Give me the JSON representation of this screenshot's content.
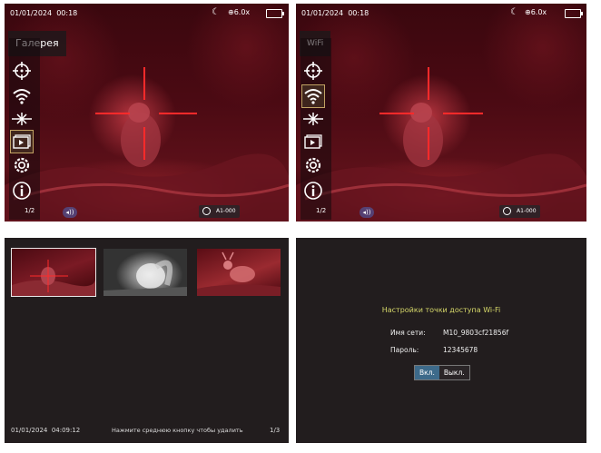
{
  "panels": {
    "gallery_menu": {
      "date": "01/01/2024",
      "time": "00:18",
      "zoom": "6.0x",
      "menu_title": "Галерея",
      "page": "1/2",
      "rec_label": "A1-000",
      "selected_item": "gallery"
    },
    "wifi_menu": {
      "date": "01/01/2024",
      "time": "00:18",
      "zoom": "6.0x",
      "menu_title": "WiFi",
      "page": "1/2",
      "rec_label": "A1-000",
      "selected_item": "wifi"
    },
    "gallery_view": {
      "date": "01/01/2024",
      "time": "04:09:12",
      "hint": "Нажмите среднюю кнопку чтобы удалить",
      "page": "1/3"
    },
    "wifi_settings": {
      "title": "Настройки точки доступа Wi-Fi",
      "ssid_label": "Имя сети:",
      "ssid_value": "M10_9803cf21856f",
      "password_label": "Пароль:",
      "password_value": "12345678",
      "on_label": "Вкл.",
      "off_label": "Выкл."
    }
  },
  "menu_icons": [
    "crosshair-icon",
    "wifi-icon",
    "brightness-icon",
    "gallery-icon",
    "settings-icon",
    "info-icon"
  ],
  "colors": {
    "accent_title": "#d6d86a",
    "button_on": "#3d6a8a",
    "reticle": "#ff2a2a",
    "panel_bg": "#221d1e"
  }
}
